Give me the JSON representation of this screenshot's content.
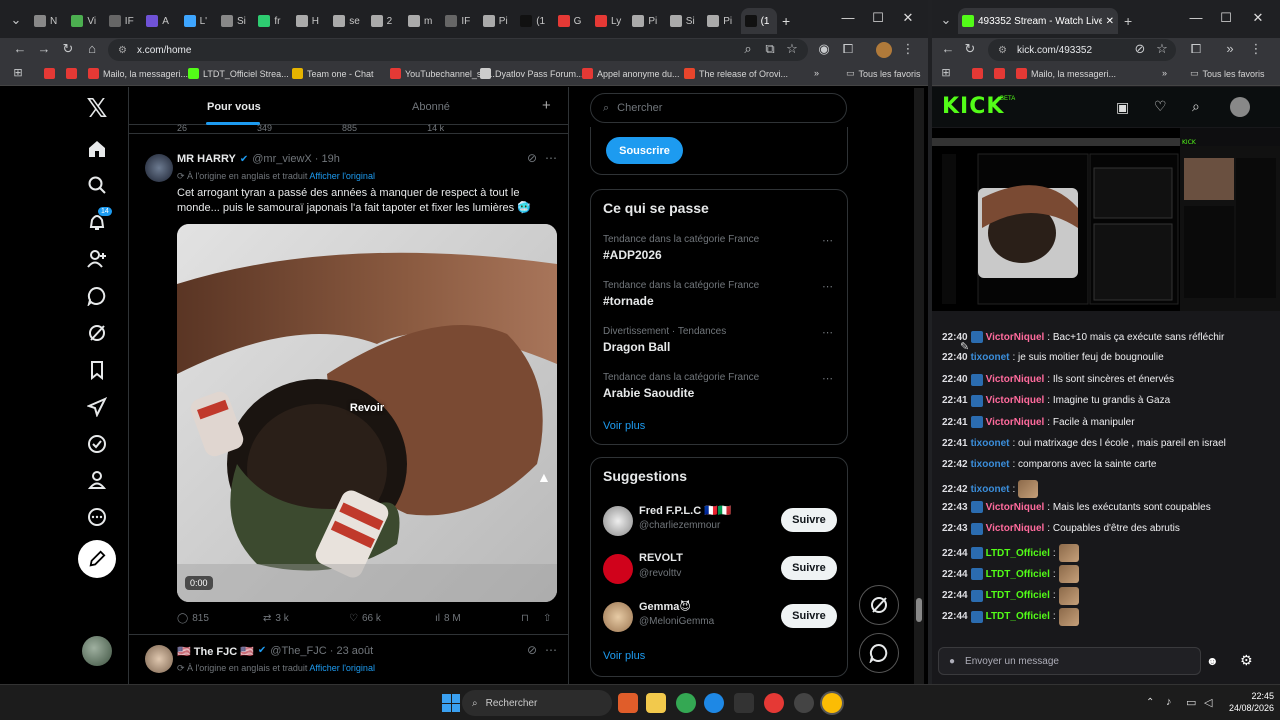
{
  "left_browser": {
    "tabs": [
      {
        "label": "N",
        "color": "#888"
      },
      {
        "label": "Vi",
        "color": "#4caf50"
      },
      {
        "label": "IF",
        "color": "#666"
      },
      {
        "label": "A",
        "color": "#6f52d6"
      },
      {
        "label": "L'",
        "color": "#3ea6ff"
      },
      {
        "label": "Si",
        "color": "#888"
      },
      {
        "label": "fr",
        "color": "#2ecc71"
      },
      {
        "label": "H",
        "color": "#aaa"
      },
      {
        "label": "se",
        "color": "#aaa"
      },
      {
        "label": "2",
        "color": "#aaa"
      },
      {
        "label": "m",
        "color": "#aaa"
      },
      {
        "label": "IF",
        "color": "#666"
      },
      {
        "label": "Pi",
        "color": "#aaa"
      },
      {
        "label": "(1",
        "color": "#111"
      },
      {
        "label": "G",
        "color": "#e53935"
      },
      {
        "label": "Ly",
        "color": "#e53935"
      },
      {
        "label": "Pi",
        "color": "#aaa"
      },
      {
        "label": "Si",
        "color": "#aaa"
      },
      {
        "label": "Pi",
        "color": "#aaa"
      },
      {
        "label": "(1",
        "color": "#111"
      }
    ],
    "url": "x.com/home",
    "bookmarks": [
      {
        "label": "",
        "color": "#e53935"
      },
      {
        "label": "",
        "color": "#e53935"
      },
      {
        "label": "Mailo, la messageri...",
        "color": "#e53935"
      },
      {
        "label": "LTDT_Officiel Strea...",
        "color": "#53fc18"
      },
      {
        "label": "Team one - Chat",
        "color": "#e6b400"
      },
      {
        "label": "YouTubechannel_sw...",
        "color": "#e53935"
      },
      {
        "label": "Dyatlov Pass Forum...",
        "color": "#ccc"
      },
      {
        "label": "Appel anonyme du...",
        "color": "#e53935"
      },
      {
        "label": "The release of Orovi...",
        "color": "#e8452c"
      }
    ],
    "bookmarks_folder": "Tous les favoris",
    "more": "»"
  },
  "x": {
    "feed_tabs": {
      "for_you": "Pour vous",
      "following": "Abonné"
    },
    "notification_count": "14",
    "search_placeholder": "Chercher",
    "subscribe": "Souscrire",
    "prev_stats": {
      "replies": "26",
      "reposts": "349",
      "likes": "885",
      "views": "14 k"
    },
    "post": {
      "name": "MR HARRY",
      "handle": "@mr_viewX · 19h",
      "translated": "À l'origine en anglais et traduit",
      "show_original": "Afficher l'original",
      "text": "Cet arrogant tyran a passé des années à manquer de respect à tout le monde... puis le samouraï japonais l'a fait tapoter et fixer les lumières 🥶",
      "replay": "Revoir",
      "time": "0:00",
      "replies": "815",
      "reposts": "3 k",
      "likes": "66 k",
      "views": "8 M"
    },
    "post2": {
      "name": "🇺🇸 The FJC 🇺🇸",
      "handle": "@The_FJC · 23 août",
      "translated": "À l'origine en anglais et traduit",
      "show_original": "Afficher l'original"
    },
    "trends_title": "Ce qui se passe",
    "trends": [
      {
        "meta": "Tendance dans la catégorie France",
        "name": "#ADP2026"
      },
      {
        "meta": "Tendance dans la catégorie France",
        "name": "#tornade"
      },
      {
        "meta": "Divertissement · Tendances",
        "name": "Dragon Ball"
      },
      {
        "meta": "Tendance dans la catégorie France",
        "name": "Arabie Saoudite"
      }
    ],
    "see_more": "Voir plus",
    "suggestions_title": "Suggestions",
    "suggestions": [
      {
        "name": "Fred F.P.L.C 🇫🇷🇮🇹",
        "handle": "@charliezemmour",
        "button": "Suivre"
      },
      {
        "name": "REVOLT",
        "handle": "@revolttv",
        "button": "Suivre"
      },
      {
        "name": "Gemma😈",
        "handle": "@MeloniGemma",
        "button": "Suivre"
      }
    ],
    "see_more2": "Voir plus"
  },
  "right_browser": {
    "tab_title": "493352 Stream - Watch Live on",
    "url": "kick.com/493352",
    "bookmarks": [
      {
        "label": "",
        "color": "#e53935"
      },
      {
        "label": "",
        "color": "#e53935"
      },
      {
        "label": "Mailo, la messageri...",
        "color": "#e53935"
      }
    ],
    "more": "»",
    "bookmarks_folder": "Tous les favoris"
  },
  "kick": {
    "logo": "KICK",
    "beta": "BETA",
    "chat": [
      {
        "time": "22:40",
        "user": "VictorNiquel",
        "cls": "u1",
        "text": ": Bac+10 mais ça exécute sans réfléchir",
        "badge": true
      },
      {
        "time": "22:40",
        "user": "tixoonet",
        "cls": "u2",
        "text": ": je suis moitier feuj de bougnoulie",
        "badge": false
      },
      {
        "time": "22:40",
        "user": "VictorNiquel",
        "cls": "u1",
        "text": ": Ils sont sincères et énervés",
        "badge": true
      },
      {
        "time": "22:41",
        "user": "VictorNiquel",
        "cls": "u1",
        "text": ": Imagine tu grandis à Gaza",
        "badge": true
      },
      {
        "time": "22:41",
        "user": "VictorNiquel",
        "cls": "u1",
        "text": ": Facile à manipuler",
        "badge": true
      },
      {
        "time": "22:41",
        "user": "tixoonet",
        "cls": "u2",
        "text": ": oui matrixage des l école , mais pareil en israel",
        "badge": false
      },
      {
        "time": "22:42",
        "user": "tixoonet",
        "cls": "u2",
        "text": ": comparons avec la sainte carte",
        "badge": false
      },
      {
        "time": "22:42",
        "user": "tixoonet",
        "cls": "u2",
        "text": ":",
        "badge": false,
        "emote": true
      },
      {
        "time": "22:43",
        "user": "VictorNiquel",
        "cls": "u1",
        "text": ": Mais les exécutants sont coupables",
        "badge": true
      },
      {
        "time": "22:43",
        "user": "VictorNiquel",
        "cls": "u1",
        "text": ": Coupables d'être des abrutis",
        "badge": true
      },
      {
        "time": "22:44",
        "user": "LTDT_Officiel",
        "cls": "u3",
        "text": ":",
        "badge": true,
        "emote": true
      },
      {
        "time": "22:44",
        "user": "LTDT_Officiel",
        "cls": "u3",
        "text": ":",
        "badge": true,
        "emote": true
      },
      {
        "time": "22:44",
        "user": "LTDT_Officiel",
        "cls": "u3",
        "text": ":",
        "badge": true,
        "emote": true
      },
      {
        "time": "22:44",
        "user": "LTDT_Officiel",
        "cls": "u3",
        "text": ":",
        "badge": true,
        "emote": true
      }
    ],
    "chat_placeholder": "Envoyer un message"
  },
  "taskbar": {
    "search": "Rechercher",
    "time": "22:45",
    "date": "24/08/2026"
  },
  "colors": {
    "x_blue": "#1d9bf0",
    "kick_green": "#53fc18"
  }
}
